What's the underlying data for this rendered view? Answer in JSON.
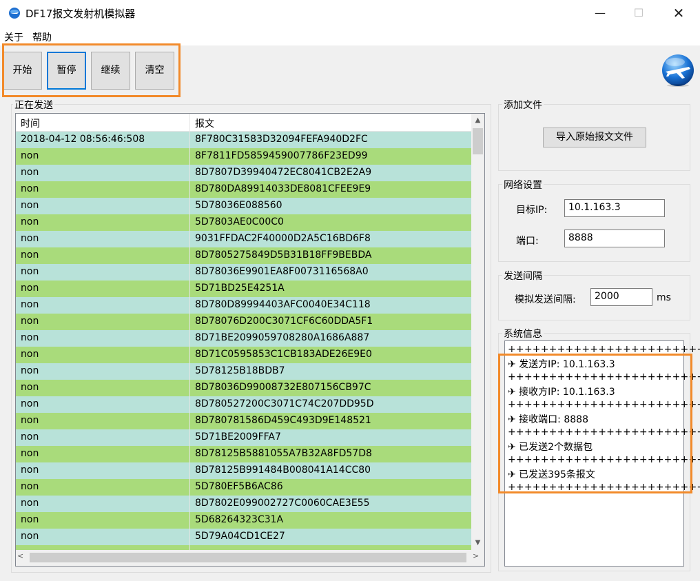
{
  "window": {
    "title": "DF17报文发射机模拟器",
    "minimize": "—",
    "maximize": "☐",
    "close": "✕"
  },
  "menu": {
    "about": "关于",
    "help": "帮助"
  },
  "toolbar": {
    "start": "开始",
    "pause": "暂停",
    "resume": "继续",
    "clear": "清空"
  },
  "sending": {
    "group_title": "正在发送",
    "columns": {
      "time": "时间",
      "message": "报文"
    },
    "rows": [
      {
        "time": "2018-04-12 08:56:46:508",
        "message": "8F780C31583D32094FEFA940D2FC"
      },
      {
        "time": "non",
        "message": "8F7811FD5859459007786F23ED99"
      },
      {
        "time": "non",
        "message": "8D7807D39940472EC8041CB2E2A9"
      },
      {
        "time": "non",
        "message": "8D780DA89914033DE8081CFEE9E9"
      },
      {
        "time": "non",
        "message": "5D78036E088560"
      },
      {
        "time": "non",
        "message": "5D7803AE0C00C0"
      },
      {
        "time": "non",
        "message": "9031FFDAC2F40000D2A5C16BD6F8"
      },
      {
        "time": "non",
        "message": "8D7805275849D5B31B18FF9BEBDA"
      },
      {
        "time": "non",
        "message": "8D78036E9901EA8F0073116568A0"
      },
      {
        "time": "non",
        "message": "5D71BD25E4251A"
      },
      {
        "time": "non",
        "message": "8D780D89994403AFC0040E34C118"
      },
      {
        "time": "non",
        "message": "8D78076D200C3071CF6C60DDA5F1"
      },
      {
        "time": "non",
        "message": "8D71BE2099059708280A1686A887"
      },
      {
        "time": "non",
        "message": "8D71C0595853C1CB183ADE26E9E0"
      },
      {
        "time": "non",
        "message": "5D78125B18BDB7"
      },
      {
        "time": "non",
        "message": "8D78036D99008732E807156CB97C"
      },
      {
        "time": "non",
        "message": "8D780527200C3071C74C207DD95D"
      },
      {
        "time": "non",
        "message": "8D780781586D459C493D9E148521"
      },
      {
        "time": "non",
        "message": "5D71BE2009FFA7"
      },
      {
        "time": "non",
        "message": "8D78125B5881055A7B32A8FD57D8"
      },
      {
        "time": "non",
        "message": "8D78125B991484B008041A14CC80"
      },
      {
        "time": "non",
        "message": "5D780EF5B6AC86"
      },
      {
        "time": "non",
        "message": "8D7802E099002727C0060CAE3E55"
      },
      {
        "time": "non",
        "message": "5D68264323C31A"
      },
      {
        "time": "non",
        "message": "5D79A04CD1CE27"
      },
      {
        "time": "",
        "message": ""
      }
    ]
  },
  "add_file": {
    "group_title": "添加文件",
    "import_button": "导入原始报文文件"
  },
  "network": {
    "group_title": "网络设置",
    "target_ip_label": "目标IP:",
    "target_ip_value": "10.1.163.3",
    "port_label": "端口:",
    "port_value": "8888"
  },
  "interval": {
    "group_title": "发送间隔",
    "label": "模拟发送间隔:",
    "value": "2000",
    "unit": "ms"
  },
  "sysinfo": {
    "group_title": "系统信息",
    "separator": "++++++++++++++++++++++++",
    "lines": [
      "✈ 发送方IP: 10.1.163.3",
      "✈ 接收方IP: 10.1.163.3",
      "✈ 接收端口: 8888",
      "✈ 已发送2个数据包",
      "✈ 已发送395条报文"
    ]
  },
  "scroll": {
    "up": "▲",
    "down": "▼",
    "left": "<",
    "right": ">"
  },
  "colors": {
    "row_odd": "#b8e2d9",
    "row_even": "#a9db7b",
    "highlight": "#f28a2a",
    "focus": "#0078d7"
  }
}
